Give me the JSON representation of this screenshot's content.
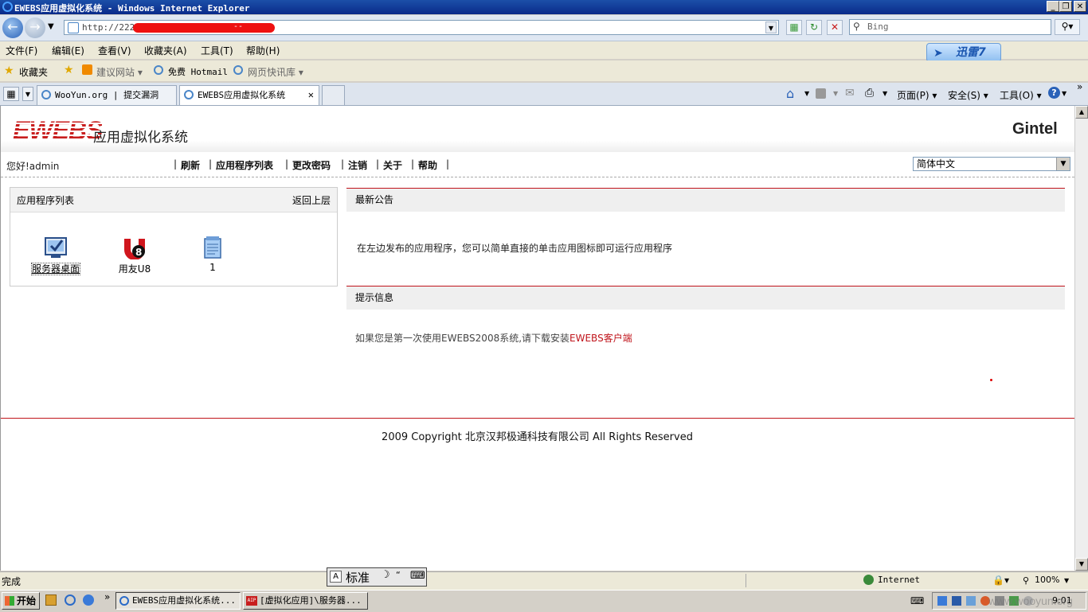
{
  "window": {
    "title": "EWEBS应用虚拟化系统 - Windows Internet Explorer",
    "min_label": "_",
    "max_label": "❐",
    "close_label": "✕"
  },
  "address_bar": {
    "url": "http://222.",
    "url_tail": "--",
    "search_placeholder": "Bing"
  },
  "menu": [
    "文件(F)",
    "编辑(E)",
    "查看(V)",
    "收藏夹(A)",
    "工具(T)",
    "帮助(H)"
  ],
  "xunlei": {
    "label": "迅雷7"
  },
  "favorites": {
    "label": "收藏夹",
    "items": [
      "建议网站 ▾",
      "免费 Hotmail",
      "网页快讯库 ▾"
    ]
  },
  "tabs": [
    {
      "label": "WooYun.org | 提交漏洞"
    },
    {
      "label": "EWEBS应用虚拟化系统",
      "close": "✕"
    }
  ],
  "command_bar": [
    "页面(P) ▾",
    "安全(S) ▾",
    "工具(O) ▾"
  ],
  "page": {
    "logo": "EWEBS",
    "logo_sub": "应用虚拟化系统",
    "brand": "Gintel",
    "greeting": "您好!admin",
    "nav": [
      "刷新",
      "应用程序列表",
      "更改密码",
      "注销",
      "关于",
      "帮助"
    ],
    "nav_sep": "|",
    "language": "简体中文",
    "app_panel": {
      "title": "应用程序列表",
      "back": "返回上层",
      "apps": [
        {
          "label": "服务器桌面",
          "icon": "server-desktop-icon"
        },
        {
          "label": "用友U8",
          "icon": "yonyou-u8-icon"
        },
        {
          "label": "1",
          "icon": "notepad-icon"
        }
      ]
    },
    "notice": {
      "title": "最新公告",
      "text": "在左边发布的应用程序，您可以简单直接的单击应用图标即可运行应用程序"
    },
    "tips": {
      "title": "提示信息",
      "text": "如果您是第一次使用EWEBS2008系统,请下载安装",
      "link": "EWEBS客户端"
    },
    "copyright": "2009 Copyright 北京汉邦极通科技有限公司  All Rights Reserved"
  },
  "status": {
    "text": "完成",
    "zone": "Internet",
    "zoom": "100%"
  },
  "ime": {
    "label": "标准"
  },
  "taskbar": {
    "start": "开始",
    "tasks": [
      "EWEBS应用虚拟化系统...",
      "[虚拟化应用]\\服务器..."
    ],
    "clock": "9:01",
    "watermark": "www.wooyun.org"
  },
  "colors": {
    "accent_red": "#c0141b",
    "title_blue": "#0a2a8a"
  }
}
